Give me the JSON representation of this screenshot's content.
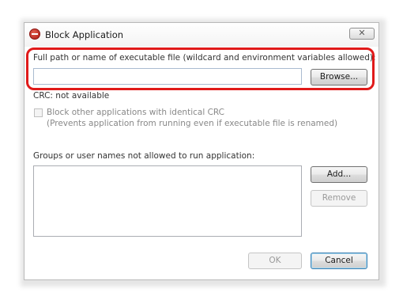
{
  "window": {
    "title": "Block Application",
    "close_glyph": "✕",
    "title_icon": "stop-icon"
  },
  "path_section": {
    "label": "Full path or name of executable file (wildcard and environment variables allowed):",
    "value": "",
    "browse_label": "Browse..."
  },
  "crc": {
    "status": "CRC: not available",
    "block_identical_label": "Block other applications with identical CRC",
    "block_identical_note": "(Prevents application from running even if executable file is renamed)",
    "checked": false
  },
  "groups": {
    "label": "Groups or user names not allowed to run application:",
    "items": [],
    "add_label": "Add...",
    "remove_label": "Remove"
  },
  "footer": {
    "ok_label": "OK",
    "cancel_label": "Cancel"
  },
  "colors": {
    "highlight": "#e01a1a",
    "input_border": "#aabbd0"
  }
}
